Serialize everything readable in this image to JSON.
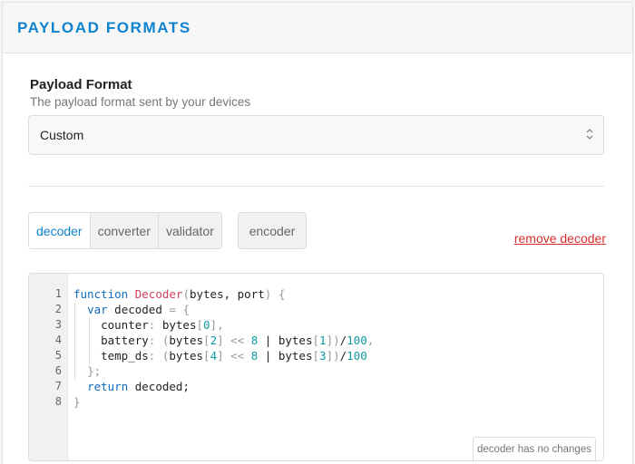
{
  "header": {
    "title": "PAYLOAD FORMATS"
  },
  "form": {
    "title": "Payload Format",
    "description": "The payload format sent by your devices",
    "select_value": "Custom"
  },
  "tabs": {
    "group": [
      {
        "label": "decoder",
        "active": true
      },
      {
        "label": "converter",
        "active": false
      },
      {
        "label": "validator",
        "active": false
      }
    ],
    "encoder": "encoder"
  },
  "remove_link": "remove decoder",
  "editor": {
    "line_numbers": [
      "1",
      "2",
      "3",
      "4",
      "5",
      "6",
      "7",
      "8"
    ],
    "lines": [
      [
        [
          "kw",
          "function"
        ],
        [
          "t",
          " "
        ],
        [
          "fn",
          "Decoder"
        ],
        [
          "op",
          "("
        ],
        [
          "t",
          "bytes, port"
        ],
        [
          "op",
          ")"
        ],
        [
          "t",
          " "
        ],
        [
          "op",
          "{"
        ]
      ],
      [
        [
          "t",
          "  "
        ],
        [
          "kw",
          "var"
        ],
        [
          "t",
          " decoded "
        ],
        [
          "op",
          "="
        ],
        [
          "t",
          " "
        ],
        [
          "op",
          "{"
        ]
      ],
      [
        [
          "t",
          "    counter"
        ],
        [
          "op",
          ":"
        ],
        [
          "t",
          " bytes"
        ],
        [
          "op",
          "["
        ],
        [
          "num",
          "0"
        ],
        [
          "op",
          "]"
        ],
        [
          "op",
          ","
        ]
      ],
      [
        [
          "t",
          "    battery"
        ],
        [
          "op",
          ":"
        ],
        [
          "t",
          " "
        ],
        [
          "op",
          "("
        ],
        [
          "t",
          "bytes"
        ],
        [
          "op",
          "["
        ],
        [
          "num",
          "2"
        ],
        [
          "op",
          "]"
        ],
        [
          "t",
          " "
        ],
        [
          "op",
          "<<"
        ],
        [
          "t",
          " "
        ],
        [
          "num",
          "8"
        ],
        [
          "t",
          " | bytes"
        ],
        [
          "op",
          "["
        ],
        [
          "num",
          "1"
        ],
        [
          "op",
          "]"
        ],
        [
          "op",
          ")"
        ],
        [
          "t",
          "/"
        ],
        [
          "num",
          "100"
        ],
        [
          "op",
          ","
        ]
      ],
      [
        [
          "t",
          "    temp_ds"
        ],
        [
          "op",
          ":"
        ],
        [
          "t",
          " "
        ],
        [
          "op",
          "("
        ],
        [
          "t",
          "bytes"
        ],
        [
          "op",
          "["
        ],
        [
          "num",
          "4"
        ],
        [
          "op",
          "]"
        ],
        [
          "t",
          " "
        ],
        [
          "op",
          "<<"
        ],
        [
          "t",
          " "
        ],
        [
          "num",
          "8"
        ],
        [
          "t",
          " | bytes"
        ],
        [
          "op",
          "["
        ],
        [
          "num",
          "3"
        ],
        [
          "op",
          "]"
        ],
        [
          "op",
          ")"
        ],
        [
          "t",
          "/"
        ],
        [
          "num",
          "100"
        ]
      ],
      [
        [
          "t",
          "  "
        ],
        [
          "op",
          "};"
        ]
      ],
      [
        [
          "t",
          "  "
        ],
        [
          "kw",
          "return"
        ],
        [
          "t",
          " decoded;"
        ]
      ],
      [
        [
          "op",
          "}"
        ]
      ]
    ],
    "status": "decoder has no changes"
  },
  "colors": {
    "accent": "#0d83d0",
    "danger": "#d62e2e"
  }
}
